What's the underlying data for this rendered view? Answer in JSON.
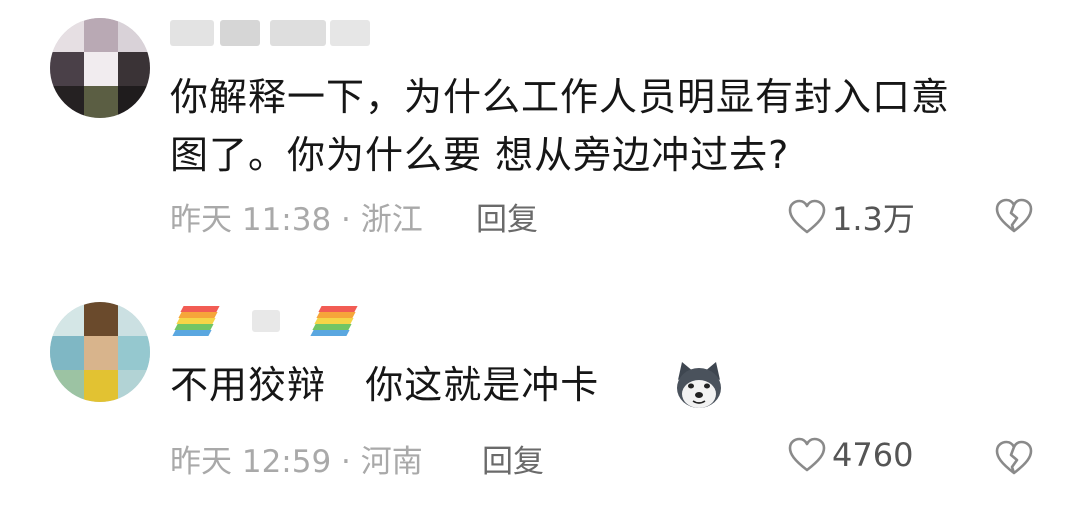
{
  "comments": [
    {
      "text_lines": [
        "你解释一下，为什么工作人员明显有封入口意",
        "图了。你为什么要 想从旁边冲过去?"
      ],
      "meta": "昨天 11:38 · 浙江",
      "reply_label": "回复",
      "like_count": "1.3万",
      "icons": [
        "blurred-avatar",
        "heart-icon",
        "dislike-broken-heart-icon"
      ]
    },
    {
      "text_lines": [
        "不用狡辩   你这就是冲卡"
      ],
      "meta": "昨天 12:59 · 河南",
      "reply_label": "回复",
      "like_count": "4760",
      "icons": [
        "blurred-avatar",
        "rainbow-emoji",
        "husky-dog-emoji",
        "heart-icon",
        "dislike-broken-heart-icon"
      ]
    }
  ],
  "colors": {
    "text": "#161616",
    "meta": "#a9a9a9",
    "reply": "#6a6a6a",
    "icon": "#8a8a8a"
  }
}
